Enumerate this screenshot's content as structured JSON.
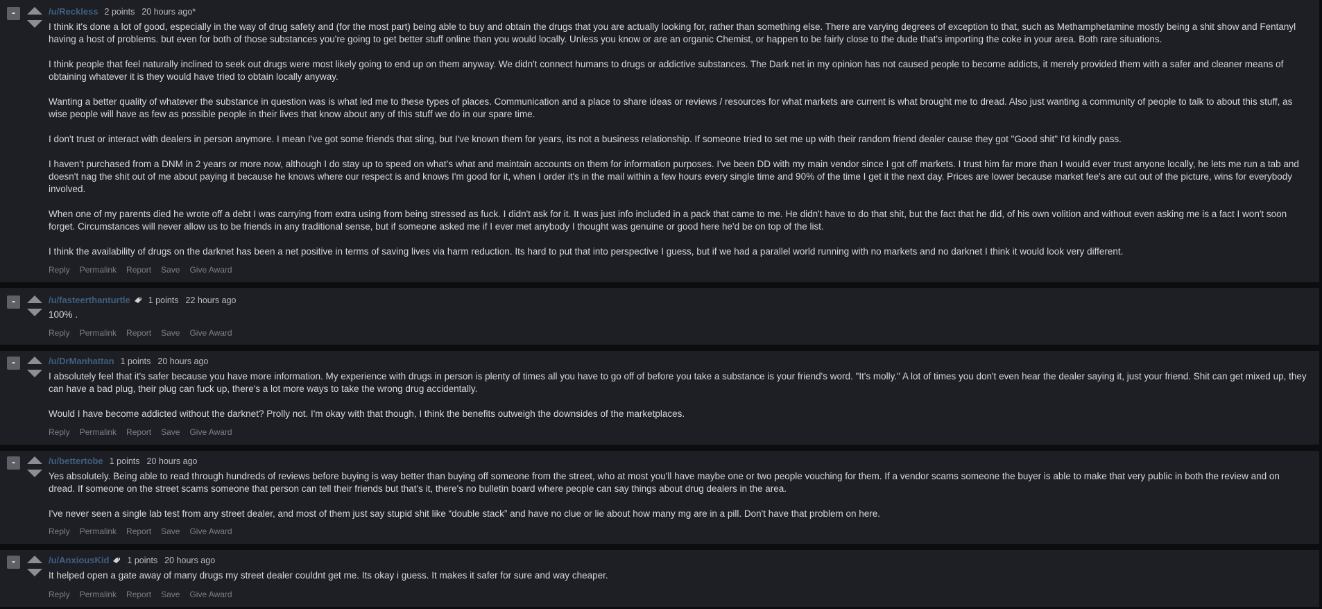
{
  "action_labels": {
    "reply": "Reply",
    "permalink": "Permalink",
    "report": "Report",
    "save": "Save",
    "give_award": "Give Award"
  },
  "collapse_symbol": "-",
  "colors": {
    "page_background": "#0c0d0f",
    "comment_background": "#1d1f24",
    "author_link": "#3e5f82",
    "action_text": "#7c7f84"
  },
  "comments": [
    {
      "author": "/u/Reckless",
      "has_flair": false,
      "points": "2 points",
      "time": "20 hours ago*",
      "paragraphs": [
        "I think it's done a lot of good, especially in the way of drug safety and (for the most part) being able to buy and obtain the drugs that you are actually looking for, rather than something else. There are varying degrees of exception to that, such as Methamphetamine mostly being a shit show and Fentanyl having a host of problems. but even for both of those substances you're going to get better stuff online than you would locally. Unless you know or are an organic Chemist, or happen to be fairly close to the dude that's importing the coke in your area. Both rare situations.",
        "I think people that feel naturally inclined to seek out drugs were most likely going to end up on them anyway. We didn't connect humans to drugs or addictive substances. The Dark net in my opinion has not caused people to become addicts, it merely provided them with a safer and cleaner means of obtaining whatever it is they would have tried to obtain locally anyway.",
        "Wanting a better quality of whatever the substance in question was is what led me to these types of places. Communication and a place to share ideas or reviews / resources for what markets are current is what brought me to dread. Also just wanting a community of people to talk to about this stuff, as wise people will have as few as possible people in their lives that know about any of this stuff we do in our spare time.",
        "I don't trust or interact with dealers in person anymore. I mean I've got some friends that sling, but I've known them for years, its not a business relationship. If someone tried to set me up with their random friend dealer cause they got \"Good shit\" I'd kindly pass.",
        "I haven't purchased from a DNM in 2 years or more now, although I do stay up to speed on what's what and maintain accounts on them for information purposes. I've been DD with my main vendor since I got off markets. I trust him far more than I would ever trust anyone locally, he lets me run a tab and doesn't nag the shit out of me about paying it because he knows where our respect is and knows I'm good for it, when I order it's in the mail within a few hours every single time and 90% of the time I get it the next day. Prices are lower because market fee's are cut out of the picture, wins for everybody involved.",
        "When one of my parents died he wrote off a debt I was carrying from extra using from being stressed as fuck. I didn't ask for it. It was just info included in a pack that came to me. He didn't have to do that shit, but the fact that he did, of his own volition and without even asking me is a fact I won't soon forget. Circumstances will never allow us to be friends in any traditional sense, but if someone asked me if I ever met anybody I thought was genuine or good here he'd be on top of the list.",
        "I think the availability of drugs on the darknet has been a net positive in terms of saving lives via harm reduction. Its hard to put that into perspective I guess, but if we had a parallel world running with no markets and no darknet I think it would look very different."
      ]
    },
    {
      "author": "/u/fasteerthanturtle",
      "has_flair": true,
      "points": "1 points",
      "time": "22 hours ago",
      "paragraphs": [
        "100% ."
      ]
    },
    {
      "author": "/u/DrManhattan",
      "has_flair": false,
      "points": "1 points",
      "time": "20 hours ago",
      "paragraphs": [
        "I absolutely feel that it's safer because you have more information. My experience with drugs in person is plenty of times all you have to go off of before you take a substance is your friend's word. \"It's molly.\" A lot of times you don't even hear the dealer saying it, just your friend. Shit can get mixed up, they can have a bad plug, their plug can fuck up, there's a lot more ways to take the wrong drug accidentally.",
        "Would I have become addicted without the darknet? Prolly not. I'm okay with that though, I think the benefits outweigh the downsides of the marketplaces."
      ]
    },
    {
      "author": "/u/bettertobe",
      "has_flair": false,
      "points": "1 points",
      "time": "20 hours ago",
      "paragraphs": [
        "Yes absolutely. Being able to read through hundreds of reviews before buying is way better than buying off someone from the street, who at most you'll have maybe one or two people vouching for them. If a vendor scams someone the buyer is able to make that very public in both the review and on dread. If someone on the street scams someone that person can tell their friends but that's it, there's no bulletin board where people can say things about drug dealers in the area.",
        "I've never seen a single lab test from any street dealer, and most of them just say stupid shit like “double stack” and have no clue or lie about how many mg are in a pill. Don't have that problem on here."
      ]
    },
    {
      "author": "/u/AnxiousKid",
      "has_flair": true,
      "points": "1 points",
      "time": "20 hours ago",
      "paragraphs": [
        "It helped open a gate away of many drugs my street dealer couldnt get me. Its okay i guess. It makes it safer for sure and way cheaper."
      ]
    }
  ]
}
